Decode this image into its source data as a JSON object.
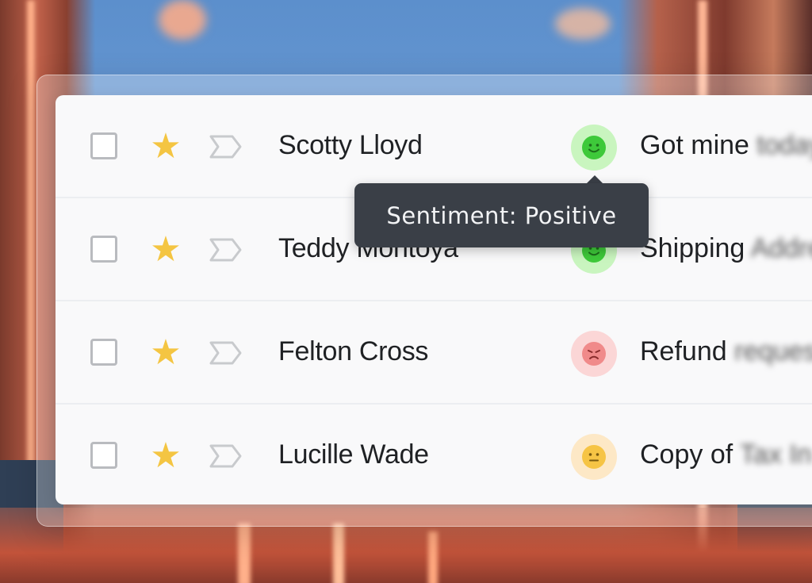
{
  "colors": {
    "star": "#f4c542",
    "positive_bg": "#c9f5bf",
    "positive_face": "#3ec93a",
    "negative_bg": "#fbd6d6",
    "negative_face": "#f08a8a",
    "neutral_bg": "#fde8c6",
    "neutral_face": "#f6c445",
    "tooltip_bg": "#3a3f47"
  },
  "tooltip": {
    "text": "Sentiment: Positive"
  },
  "rows": [
    {
      "name": "Scotty Lloyd",
      "starred": true,
      "sentiment": "positive",
      "sentiment_icon": "smile-icon",
      "subject_visible": "Got mine",
      "subject_blurred": "today"
    },
    {
      "name": "Teddy Montoya",
      "starred": true,
      "sentiment": "positive",
      "sentiment_icon": "smile-icon",
      "subject_visible": "Shipping",
      "subject_blurred": "Address"
    },
    {
      "name": "Felton Cross",
      "starred": true,
      "sentiment": "negative",
      "sentiment_icon": "sad-icon",
      "subject_visible": "Refund",
      "subject_blurred": "request"
    },
    {
      "name": "Lucille Wade",
      "starred": true,
      "sentiment": "neutral",
      "sentiment_icon": "neutral-face-icon",
      "subject_visible": "Copy of",
      "subject_blurred": "Tax In"
    }
  ]
}
